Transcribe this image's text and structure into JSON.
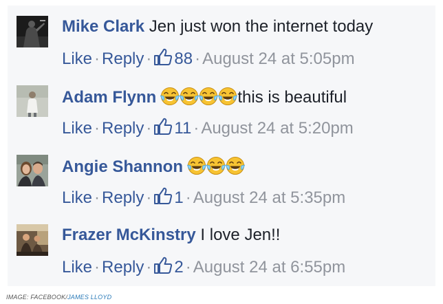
{
  "comments": [
    {
      "author": "Mike Clark",
      "text": "Jen just won the internet today",
      "emoji_count": 0,
      "emoji_icon": "",
      "like_label": "Like",
      "reply_label": "Reply",
      "separator": "·",
      "like_count": "88",
      "timestamp": "August 24 at 5:05pm"
    },
    {
      "author": "Adam Flynn",
      "text": "this is beautiful",
      "emoji_count": 4,
      "emoji_icon": "tears-of-joy-emoji-icon",
      "like_label": "Like",
      "reply_label": "Reply",
      "separator": "·",
      "like_count": "11",
      "timestamp": "August 24 at 5:20pm"
    },
    {
      "author": "Angie Shannon",
      "text": "",
      "emoji_count": 3,
      "emoji_icon": "tears-of-joy-emoji-icon",
      "like_label": "Like",
      "reply_label": "Reply",
      "separator": "·",
      "like_count": "1",
      "timestamp": "August 24 at 5:35pm"
    },
    {
      "author": "Frazer McKinstry",
      "text": "I love Jen!!",
      "emoji_count": 0,
      "emoji_icon": "",
      "like_label": "Like",
      "reply_label": "Reply",
      "separator": "·",
      "like_count": "2",
      "timestamp": "August 24 at 6:55pm"
    }
  ],
  "credit": {
    "prefix": "IMAGE: FACEBOOK/",
    "name": "JAMES LLOYD"
  },
  "colors": {
    "panel_background": "#f6f7f9",
    "author_link": "#365899",
    "body_text": "#1d2129",
    "meta_text": "#90949c",
    "credit_link": "#2a7ab8"
  },
  "icons": {
    "thumbs_up": "thumbs-up-icon",
    "emoji": "tears-of-joy-emoji-icon"
  }
}
